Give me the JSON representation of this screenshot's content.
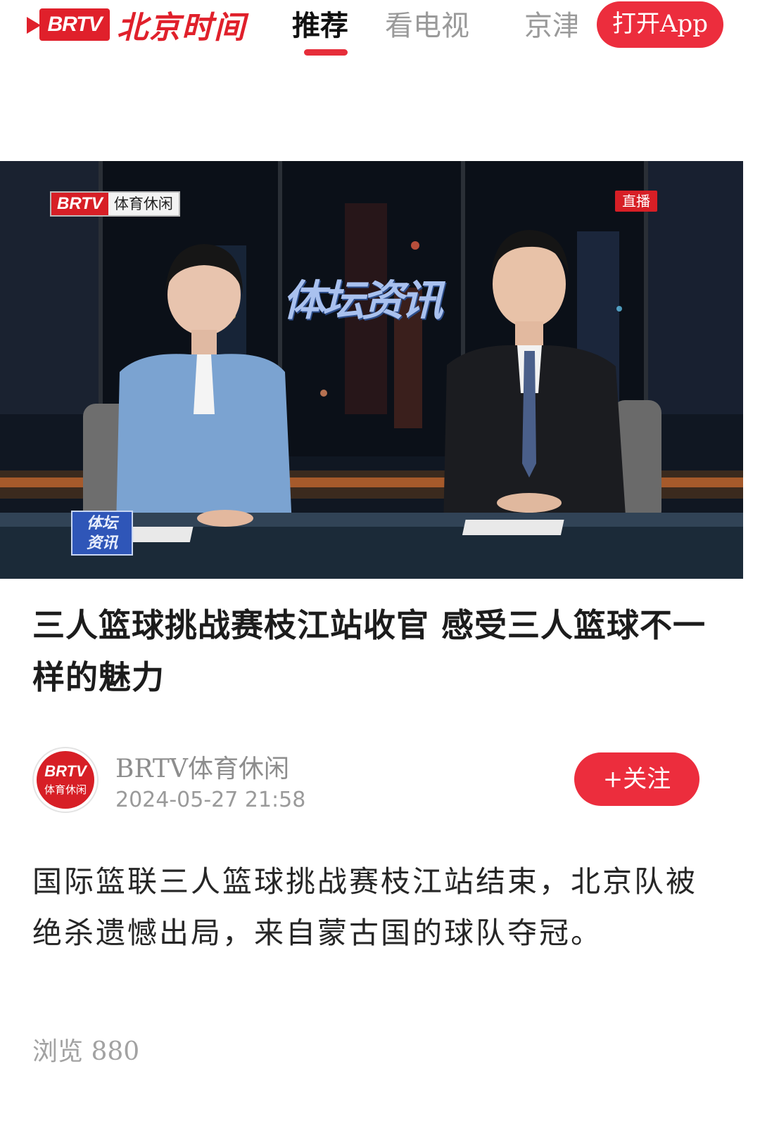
{
  "header": {
    "logo_mark": "BRTV",
    "logo_text": "北京时间",
    "nav": [
      {
        "label": "推荐",
        "active": true
      },
      {
        "label": "看电视",
        "active": false
      },
      {
        "label": "京津",
        "active": false
      }
    ],
    "open_app_label": "打开App",
    "accent_color": "#ec2d3d"
  },
  "video": {
    "channel_brand": "BRTV",
    "channel_name": "体育休闲",
    "live_badge": "直播",
    "show_title": "体坛资讯",
    "corner_logo_line1": "体坛",
    "corner_logo_line2": "资讯"
  },
  "article": {
    "title": "三人篮球挑战赛枝江站收官  感受三人篮球不一样的魅力",
    "author": {
      "avatar_brand": "BRTV",
      "avatar_sub": "体育休闲",
      "name": "BRTV体育休闲",
      "time": "2024-05-27  21:58",
      "follow_label": "+关注"
    },
    "body": "国际篮联三人篮球挑战赛枝江站结束，北京队被绝杀遗憾出局，来自蒙古国的球队夺冠。",
    "views": "浏览 880"
  }
}
